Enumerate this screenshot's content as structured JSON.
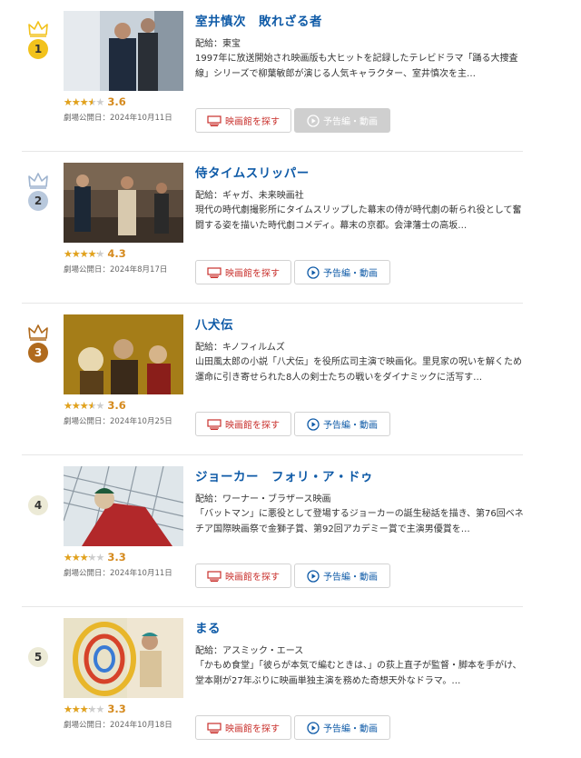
{
  "colors": {
    "title": "#0e5aa7",
    "theater": "#c9302c",
    "score": "#d58a1e",
    "gold": "#f2c21c",
    "silver": "#9fb4cf",
    "bronze": "#b06a1d",
    "plain": "#ecead6"
  },
  "rankings": [
    {
      "rank": "1",
      "medal": "gold",
      "title": "室井慎次　敗れざる者",
      "distributor": "配給：東宝",
      "description": "1997年に放送開始され映画版も大ヒットを記録したテレビドラマ「踊る大捜査線」シリーズで柳葉敏郎が演じる人気キャラクター、室井慎次を主…",
      "rating": 3.6,
      "rating_text": "3.6",
      "release": "劇場公開日：2024年10月11日",
      "theater_label": "映画館を探す",
      "trailer_label": "予告編・動画",
      "trailer_enabled": false
    },
    {
      "rank": "2",
      "medal": "silver",
      "title": "侍タイムスリッパー",
      "distributor": "配給：ギャガ、未来映画社",
      "description": "現代の時代劇撮影所にタイムスリップした幕末の侍が時代劇の斬られ役として奮闘する姿を描いた時代劇コメディ。幕末の京都。会津藩士の高坂…",
      "rating": 4.3,
      "rating_text": "4.3",
      "release": "劇場公開日：2024年8月17日",
      "theater_label": "映画館を探す",
      "trailer_label": "予告編・動画",
      "trailer_enabled": true
    },
    {
      "rank": "3",
      "medal": "bronze",
      "title": "八犬伝",
      "distributor": "配給：キノフィルムズ",
      "description": "山田風太郎の小説「八犬伝」を役所広司主演で映画化。里見家の呪いを解くため運命に引き寄せられた8人の剣士たちの戦いをダイナミックに活写す…",
      "rating": 3.6,
      "rating_text": "3.6",
      "release": "劇場公開日：2024年10月25日",
      "theater_label": "映画館を探す",
      "trailer_label": "予告編・動画",
      "trailer_enabled": true
    },
    {
      "rank": "4",
      "medal": "plain",
      "title": "ジョーカー　フォリ・ア・ドゥ",
      "distributor": "配給：ワーナー・ブラザース映画",
      "description": "「バットマン」に悪役として登場するジョーカーの誕生秘話を描き、第76回ベネチア国際映画祭で金獅子賞、第92回アカデミー賞で主演男優賞を…",
      "rating": 3.3,
      "rating_text": "3.3",
      "release": "劇場公開日：2024年10月11日",
      "theater_label": "映画館を探す",
      "trailer_label": "予告編・動画",
      "trailer_enabled": true
    },
    {
      "rank": "5",
      "medal": "plain",
      "title": "まる",
      "distributor": "配給：アスミック・エース",
      "description": "「かもめ食堂」「彼らが本気で編むときは、」の荻上直子が監督・脚本を手がけ、堂本剛が27年ぶりに映画単独主演を務めた奇想天外なドラマ。…",
      "rating": 3.3,
      "rating_text": "3.3",
      "release": "劇場公開日：2024年10月18日",
      "theater_label": "映画館を探す",
      "trailer_label": "予告編・動画",
      "trailer_enabled": true
    }
  ]
}
